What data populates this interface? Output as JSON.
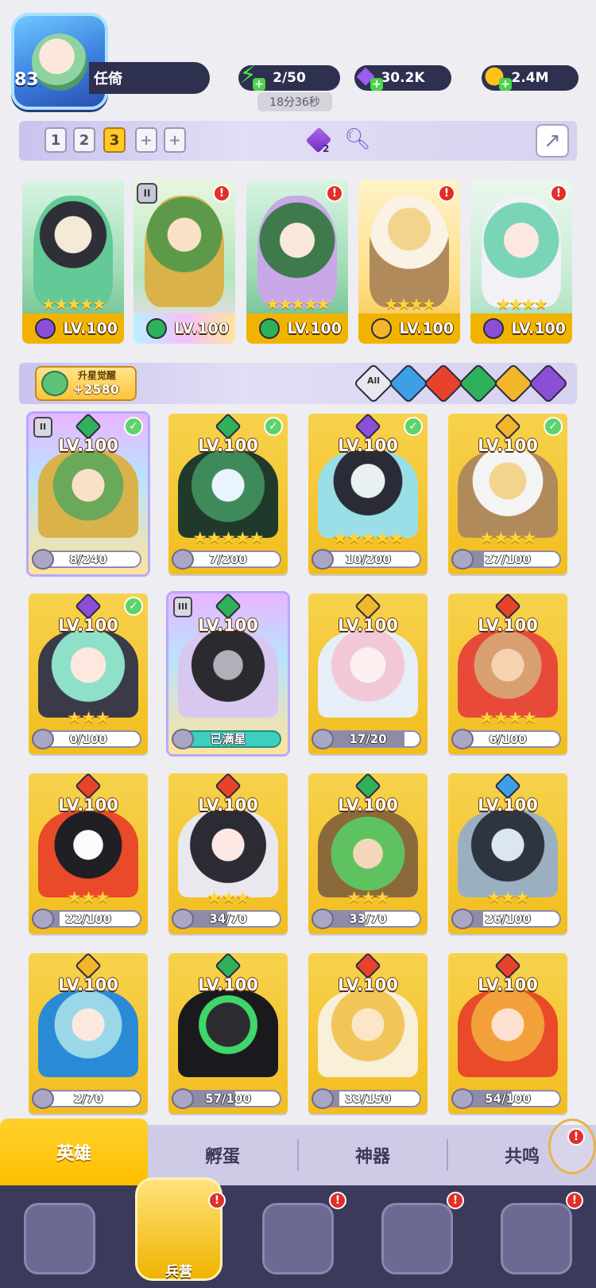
{
  "player": {
    "level": "83",
    "name": "任倚"
  },
  "resources": {
    "energy": "2/50",
    "energy_timer": "18分36秒",
    "gems": "30.2K",
    "gold": "2.4M"
  },
  "team": {
    "slots": [
      "1",
      "2",
      "3",
      "+",
      "+"
    ],
    "active_slot": "3",
    "rune_count": "2",
    "heroes": [
      {
        "level": "LV.100",
        "stars": "★★★★★",
        "element": "dark",
        "alert": false,
        "rank": ""
      },
      {
        "level": "LV.100",
        "stars": "",
        "element": "nature",
        "alert": true,
        "rank": "II"
      },
      {
        "level": "LV.100",
        "stars": "★★★★★",
        "element": "nature",
        "alert": true,
        "rank": ""
      },
      {
        "level": "LV.100",
        "stars": "★★★★",
        "element": "light",
        "alert": true,
        "rank": ""
      },
      {
        "level": "LV.100",
        "stars": "★★★★",
        "element": "dark",
        "alert": true,
        "rank": ""
      }
    ]
  },
  "filter": {
    "awaken_label": "升星觉醒",
    "awaken_value": "+2580",
    "all_label": "All",
    "elements": [
      "all",
      "water",
      "fire",
      "nature",
      "light",
      "dark"
    ]
  },
  "heroes": [
    {
      "level": "LV.100",
      "stars": "",
      "progress": "8/240",
      "pct": 0.033,
      "element": "nature",
      "checked": true,
      "rank": "II",
      "rainbow": true,
      "selected": true
    },
    {
      "level": "LV.100",
      "stars": "★★★★★",
      "progress": "7/200",
      "pct": 0.035,
      "element": "nature",
      "checked": true,
      "rank": "",
      "rainbow": false
    },
    {
      "level": "LV.100",
      "stars": "★★★★★",
      "progress": "10/200",
      "pct": 0.05,
      "element": "dark",
      "checked": true,
      "rank": "",
      "rainbow": false
    },
    {
      "level": "LV.100",
      "stars": "★★★★",
      "progress": "27/100",
      "pct": 0.27,
      "element": "light",
      "checked": true,
      "rank": "",
      "rainbow": false
    },
    {
      "level": "LV.100",
      "stars": "★★★",
      "progress": "0/100",
      "pct": 0.0,
      "element": "dark",
      "checked": true,
      "rank": "",
      "rainbow": false
    },
    {
      "level": "LV.100",
      "stars": "",
      "progress": "已满星",
      "pct": 1.0,
      "element": "nature",
      "checked": false,
      "rank": "III",
      "rainbow": true,
      "maxed": true,
      "selected": true
    },
    {
      "level": "LV.100",
      "stars": "",
      "progress": "17/20",
      "pct": 0.85,
      "element": "light",
      "checked": false,
      "rank": "",
      "rainbow": false
    },
    {
      "level": "LV.100",
      "stars": "★★★★",
      "progress": "6/100",
      "pct": 0.06,
      "element": "fire",
      "checked": false,
      "rank": "",
      "rainbow": false
    },
    {
      "level": "LV.100",
      "stars": "★★★",
      "progress": "22/100",
      "pct": 0.22,
      "element": "fire",
      "checked": false,
      "rank": "",
      "rainbow": false
    },
    {
      "level": "LV.100",
      "stars": "★★★",
      "progress": "34/70",
      "pct": 0.486,
      "element": "fire",
      "checked": false,
      "rank": "",
      "rainbow": false
    },
    {
      "level": "LV.100",
      "stars": "★★★",
      "progress": "33/70",
      "pct": 0.471,
      "element": "nature",
      "checked": false,
      "rank": "",
      "rainbow": false
    },
    {
      "level": "LV.100",
      "stars": "★★★",
      "progress": "26/100",
      "pct": 0.26,
      "element": "water",
      "checked": false,
      "rank": "",
      "rainbow": false
    },
    {
      "level": "LV.100",
      "stars": "",
      "progress": "2/70",
      "pct": 0.029,
      "element": "light",
      "checked": false,
      "rank": "",
      "rainbow": false
    },
    {
      "level": "LV.100",
      "stars": "",
      "progress": "57/100",
      "pct": 0.57,
      "element": "nature",
      "checked": false,
      "rank": "",
      "rainbow": false
    },
    {
      "level": "LV.100",
      "stars": "",
      "progress": "33/150",
      "pct": 0.22,
      "element": "fire",
      "checked": false,
      "rank": "",
      "rainbow": false
    },
    {
      "level": "LV.100",
      "stars": "",
      "progress": "54/100",
      "pct": 0.54,
      "element": "fire",
      "checked": false,
      "rank": "",
      "rainbow": false
    }
  ],
  "subtabs": [
    "英雄",
    "孵蛋",
    "神器",
    "共鸣"
  ],
  "active_subtab": "英雄",
  "bottom_nav": {
    "active_label": "兵营"
  },
  "colors": {
    "water": "#3da0e6",
    "fire": "#e8432a",
    "nature": "#2fb05a",
    "light": "#f2b62a",
    "dark": "#8a4fd6",
    "all": "#e8e8ee"
  }
}
